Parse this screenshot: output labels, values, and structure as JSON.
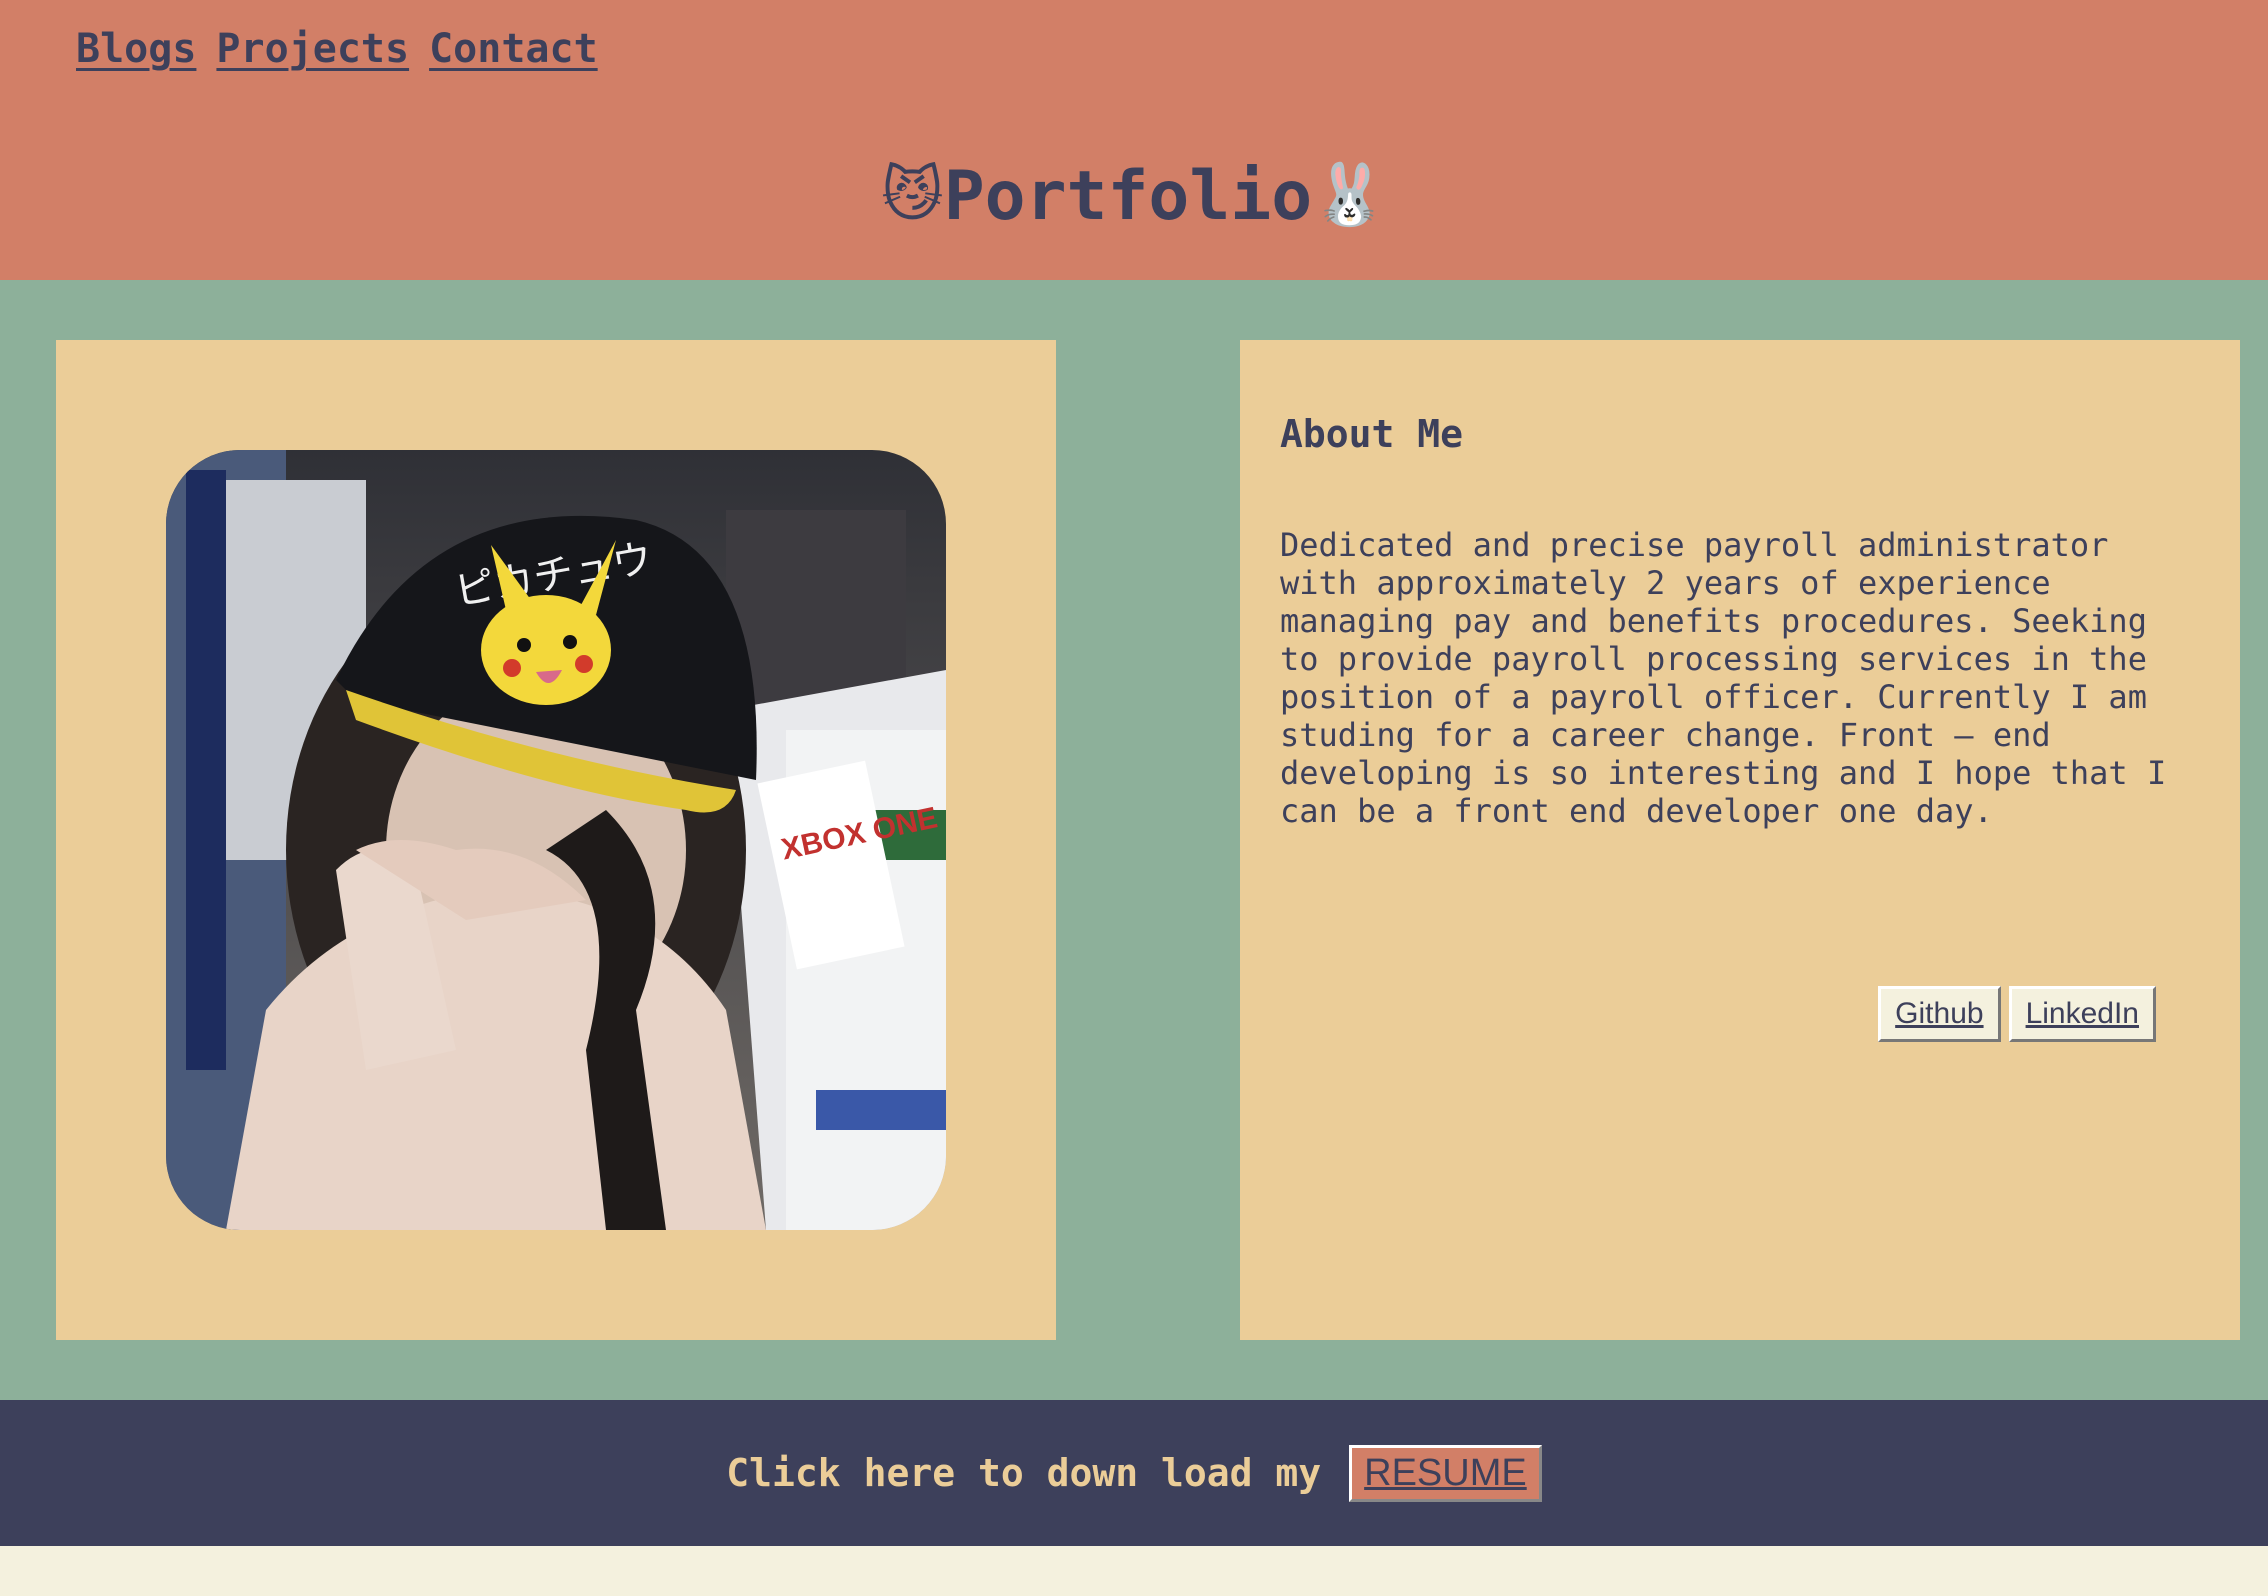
{
  "nav": {
    "items": [
      "Blogs",
      "Projects",
      "Contact"
    ]
  },
  "header": {
    "emoji_left": "😼",
    "title": "Portfolio",
    "emoji_right": "🐰"
  },
  "about": {
    "title": "About Me",
    "text": "Dedicated and precise payroll administrator with approximately 2 years of experience managing pay and benefits procedures. Seeking to provide payroll processing services in the position of a payroll officer. Currently I am studing for a career change. Front – end developing is so interesting and I hope that I can be a front end developer one day.",
    "links": [
      "Github",
      "LinkedIn"
    ]
  },
  "photo": {
    "cap_text": "ピカチュウ",
    "poster_text": "XBOX ONE"
  },
  "footer": {
    "text": "Click here to down load my",
    "button": "RESUME"
  },
  "colors": {
    "header_bg": "#d27f67",
    "main_bg": "#8db09a",
    "card_bg": "#ebcd98",
    "footer_bg": "#3d405b",
    "text": "#3d405b",
    "page_bg": "#f4f1de"
  }
}
